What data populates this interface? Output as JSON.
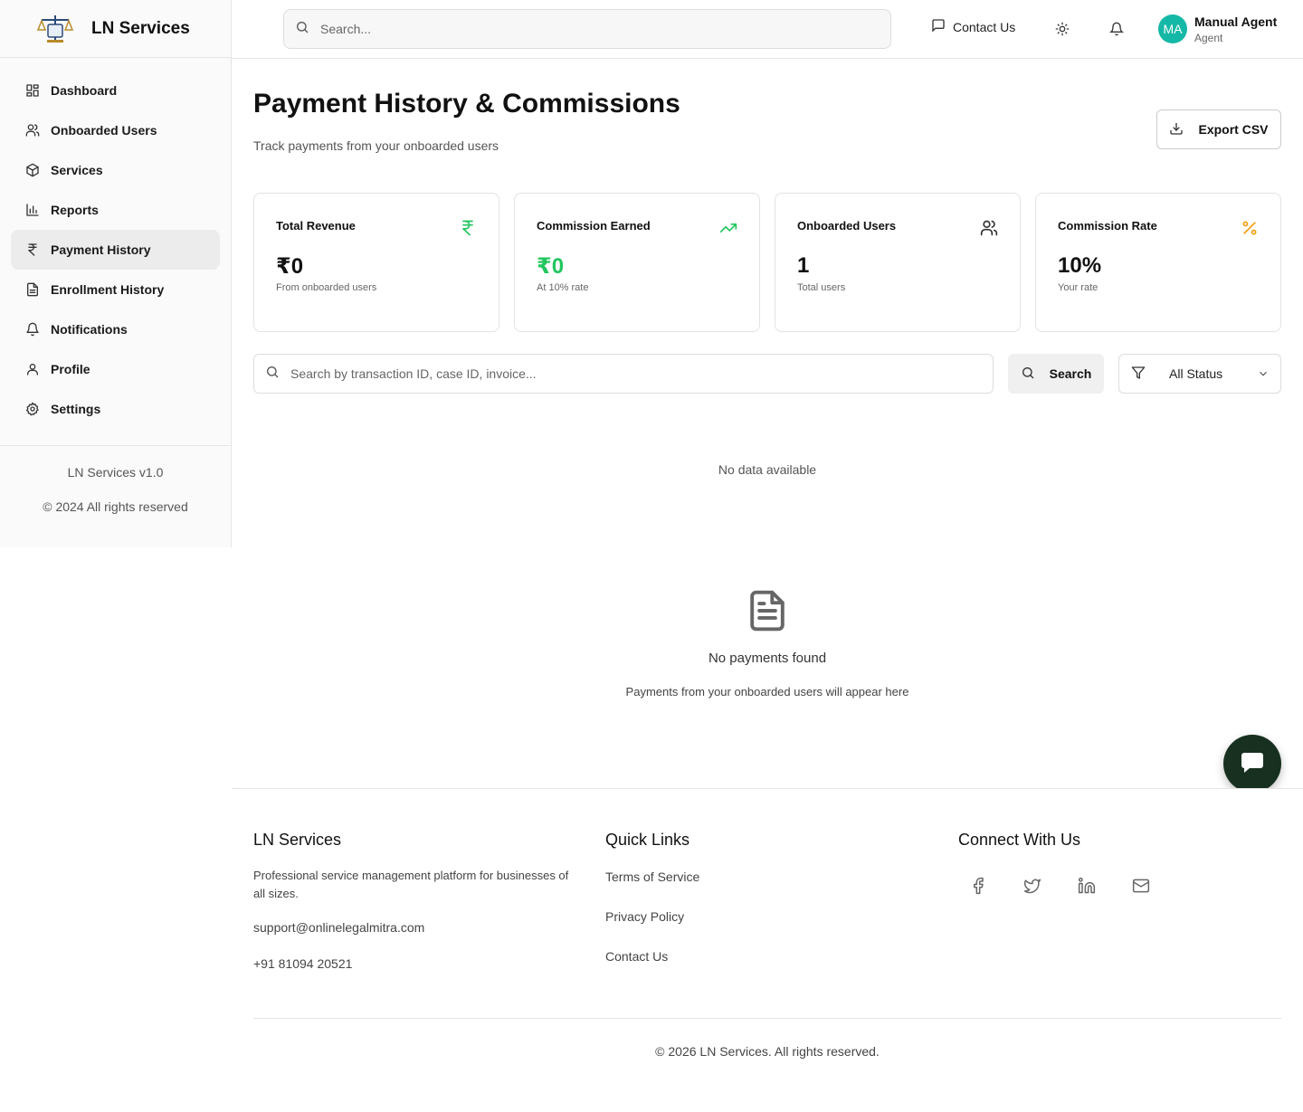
{
  "brand": {
    "name": "LN Services"
  },
  "sidebar": {
    "items": [
      {
        "label": "Dashboard",
        "icon": "dashboard-icon"
      },
      {
        "label": "Onboarded Users",
        "icon": "users-icon"
      },
      {
        "label": "Services",
        "icon": "package-icon"
      },
      {
        "label": "Reports",
        "icon": "bar-chart-icon"
      },
      {
        "label": "Payment History",
        "icon": "rupee-icon",
        "active": true
      },
      {
        "label": "Enrollment History",
        "icon": "file-text-icon"
      },
      {
        "label": "Notifications",
        "icon": "bell-icon"
      },
      {
        "label": "Profile",
        "icon": "user-icon"
      },
      {
        "label": "Settings",
        "icon": "gear-icon"
      }
    ],
    "version": "LN Services v1.0",
    "copyright": "© 2024 All rights reserved"
  },
  "header": {
    "search_placeholder": "Search...",
    "contact_label": "Contact Us",
    "user": {
      "initials": "MA",
      "name": "Manual Agent",
      "role": "Agent"
    }
  },
  "page": {
    "title": "Payment History & Commissions",
    "subtitle": "Track payments from your onboarded users",
    "export_label": "Export CSV"
  },
  "stats": [
    {
      "label": "Total Revenue",
      "value": "₹0",
      "note": "From onboarded users",
      "icon": "rupee-icon",
      "color": "#22c55e"
    },
    {
      "label": "Commission Earned",
      "value": "₹0",
      "note": "At 10% rate",
      "icon": "trending-up-icon",
      "color": "#22c55e"
    },
    {
      "label": "Onboarded Users",
      "value": "1",
      "note": "Total users",
      "icon": "users-icon",
      "color": "#333333"
    },
    {
      "label": "Commission Rate",
      "value": "10%",
      "note": "Your rate",
      "icon": "percent-icon",
      "color": "#f59e0b"
    }
  ],
  "filters": {
    "search_placeholder": "Search by transaction ID, case ID, invoice...",
    "search_button": "Search",
    "status_value": "All Status"
  },
  "table": {
    "no_data": "No data available"
  },
  "empty_state": {
    "title": "No payments found",
    "subtitle": "Payments from your onboarded users will appear here"
  },
  "footer": {
    "brand_title": "LN Services",
    "description": "Professional service management platform for businesses of all sizes.",
    "email": "support@onlinelegalmitra.com",
    "phone": "+91 81094 20521",
    "quick_links_title": "Quick Links",
    "links": [
      "Terms of Service",
      "Privacy Policy",
      "Contact Us"
    ],
    "connect_title": "Connect With Us",
    "social": [
      "facebook-icon",
      "twitter-icon",
      "linkedin-icon",
      "mail-icon"
    ],
    "copyright": "© 2026 LN Services. All rights reserved."
  },
  "colors": {
    "accent_green": "#22c55e",
    "accent_orange": "#f59e0b",
    "avatar": "#14b8a6",
    "chat_fab": "#17301f"
  }
}
